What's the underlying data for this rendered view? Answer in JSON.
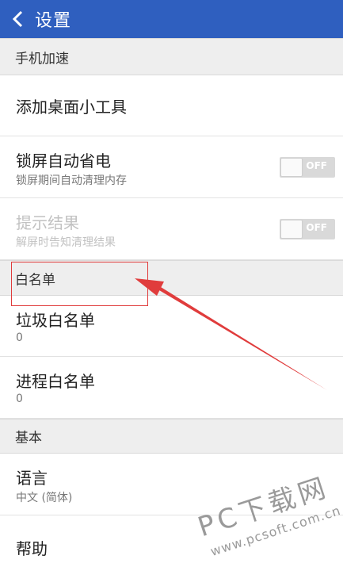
{
  "appbar": {
    "title": "设置",
    "back_icon": "chevron-left-icon"
  },
  "sections": {
    "speedup": "手机加速",
    "whitelist": "白名单",
    "basic": "基本"
  },
  "items": {
    "widget": {
      "title": "添加桌面小工具"
    },
    "lock_saver": {
      "title": "锁屏自动省电",
      "subtitle": "锁屏期间自动清理内存",
      "toggle_label": "OFF",
      "enabled": false
    },
    "prompt": {
      "title": "提示结果",
      "subtitle": "解屏时告知清理结果",
      "toggle_label": "OFF",
      "enabled": false
    },
    "junk_whitelist": {
      "title": "垃圾白名单",
      "subtitle": "0"
    },
    "process_whitelist": {
      "title": "进程白名单",
      "subtitle": "0"
    },
    "language": {
      "title": "语言",
      "subtitle": "中文 (简体)"
    },
    "help": {
      "title": "帮助"
    }
  },
  "watermark": {
    "brand": "PC下载网",
    "url": "www.pcsoft.com.cn"
  },
  "colors": {
    "appbar": "#2f5fbf",
    "annotation": "#e03c3c",
    "section_bg": "#eeeeee"
  }
}
